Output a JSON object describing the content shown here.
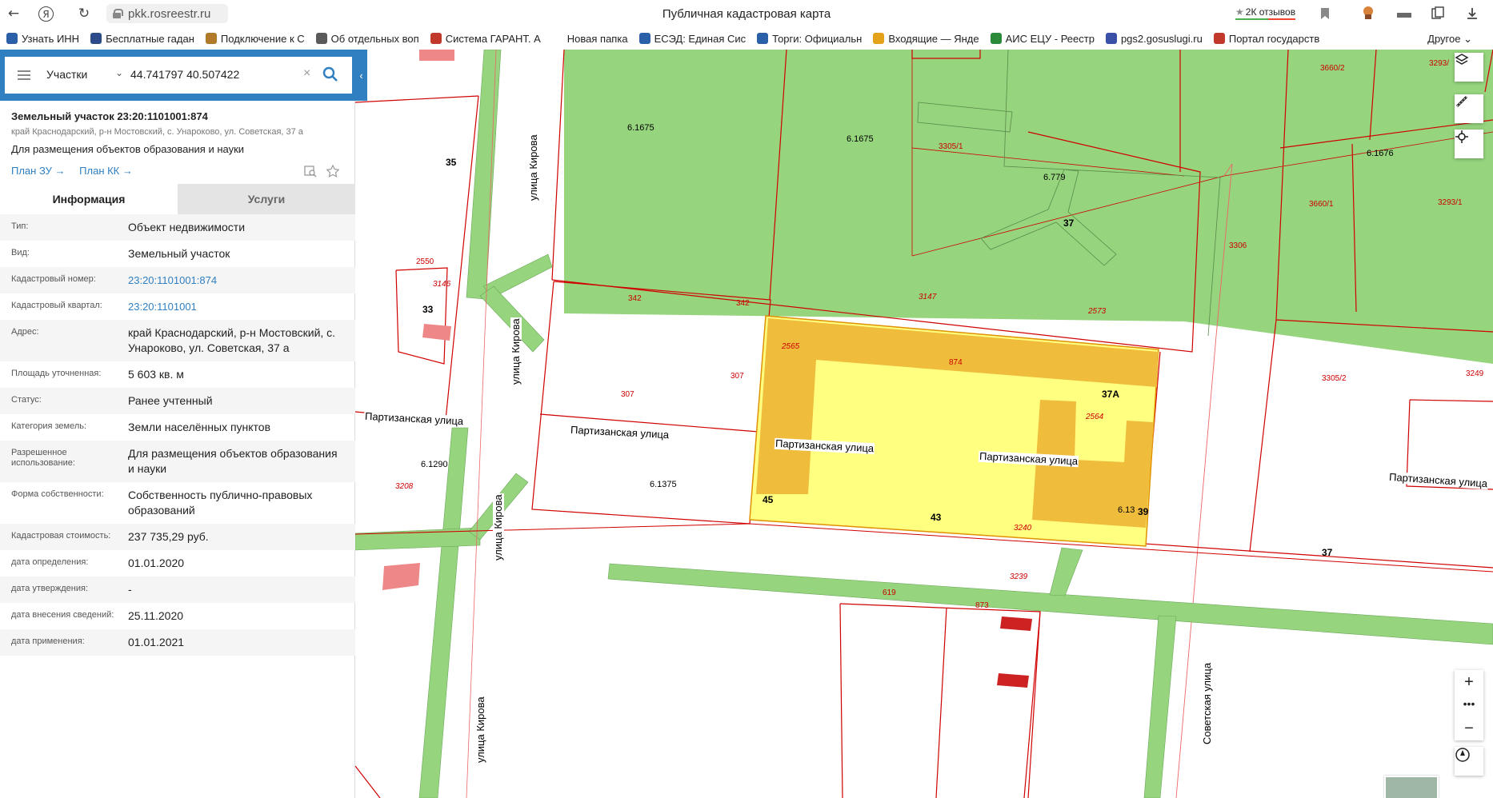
{
  "browser": {
    "url": "pkk.rosreestr.ru",
    "title": "Публичная кадастровая карта",
    "reviews": "2К отзывов",
    "bookmarks": [
      {
        "label": "Узнать ИНН",
        "color": "#2b5fa8"
      },
      {
        "label": "Бесплатные гадан",
        "color": "#2b4a8a"
      },
      {
        "label": "Подключение к С",
        "color": "#b07a2a"
      },
      {
        "label": "Об отдельных воп",
        "color": "#5a5a5a"
      },
      {
        "label": "Система ГАРАНТ. А",
        "color": "#c0392b"
      },
      {
        "label": "Новая папка",
        "color": "#ffffff"
      },
      {
        "label": "ЕСЭД: Единая Сис",
        "color": "#2b5fa8"
      },
      {
        "label": "Торги: Официальн",
        "color": "#2b5fa8"
      },
      {
        "label": "Входящие — Янде",
        "color": "#e3a21a"
      },
      {
        "label": "АИС ЕЦУ - Реестр",
        "color": "#2a8a3a"
      },
      {
        "label": "pgs2.gosuslugi.ru",
        "color": "#3a4fa8"
      },
      {
        "label": "Портал государств",
        "color": "#c0392b"
      }
    ],
    "other": "Другое"
  },
  "search": {
    "type": "Участки",
    "query": "44.741797 40.507422"
  },
  "object": {
    "title": "Земельный участок 23:20:1101001:874",
    "address_short": "край Краснодарский, р-н Мостовский, с. Унароково, ул. Советская, 37 а",
    "purpose": "Для размещения объектов образования и науки",
    "plan_zu": "План ЗУ →",
    "plan_kk": "План КК →"
  },
  "tabs": [
    "Информация",
    "Услуги"
  ],
  "rows": [
    {
      "k": "Тип:",
      "v": "Объект недвижимости",
      "link": false
    },
    {
      "k": "Вид:",
      "v": "Земельный участок",
      "link": false
    },
    {
      "k": "Кадастровый номер:",
      "v": "23:20:1101001:874",
      "link": true
    },
    {
      "k": "Кадастровый квартал:",
      "v": "23:20:1101001",
      "link": true
    },
    {
      "k": "Адрес:",
      "v": "край Краснодарский, р-н Мостовский, с. Унароково, ул. Советская, 37 а",
      "link": false
    },
    {
      "k": "Площадь уточненная:",
      "v": "5 603 кв. м",
      "link": false
    },
    {
      "k": "Статус:",
      "v": "Ранее учтенный",
      "link": false
    },
    {
      "k": "Категория земель:",
      "v": "Земли населённых пунктов",
      "link": false
    },
    {
      "k": "Разрешенное использование:",
      "v": "Для размещения объектов образования и науки",
      "link": false
    },
    {
      "k": "Форма собственности:",
      "v": "Собственность публично-правовых образований",
      "link": false
    },
    {
      "k": "Кадастровая стоимость:",
      "v": "237 735,29 руб.",
      "link": false
    },
    {
      "k": "дата определения:",
      "v": "01.01.2020",
      "link": false
    },
    {
      "k": "дата утверждения:",
      "v": "-",
      "link": false
    },
    {
      "k": "дата внесения сведений:",
      "v": "25.11.2020",
      "link": false
    },
    {
      "k": "дата применения:",
      "v": "01.01.2021",
      "link": false
    }
  ],
  "map_labels": {
    "parcels": [
      "6.1675",
      "6.1675",
      "3305/1",
      "6.779",
      "3660/2",
      "3293/",
      "6.1676",
      "3660/1",
      "3293/1",
      "3306",
      "342",
      "342",
      "3147",
      "2573",
      "2565",
      "874",
      "307",
      "307",
      "2564",
      "3305/2",
      "3249",
      "2550",
      "3146",
      "3208",
      "6.1290",
      "6.1375",
      "6.13",
      "3240",
      "3239",
      "619",
      "873"
    ],
    "numbers": [
      "35",
      "37",
      "33",
      "37А",
      "45",
      "43",
      "39",
      "37"
    ],
    "streets": {
      "kirova": "улица Кирова",
      "partizanskaya": "Партизанская улица",
      "sovetskaya": "Советская улица"
    }
  },
  "colors": {
    "accent": "#2f7fc1",
    "green_zone": "#96d47e",
    "selected": "#ffff80",
    "building": "#f0bc3c",
    "border": "#d00000"
  }
}
